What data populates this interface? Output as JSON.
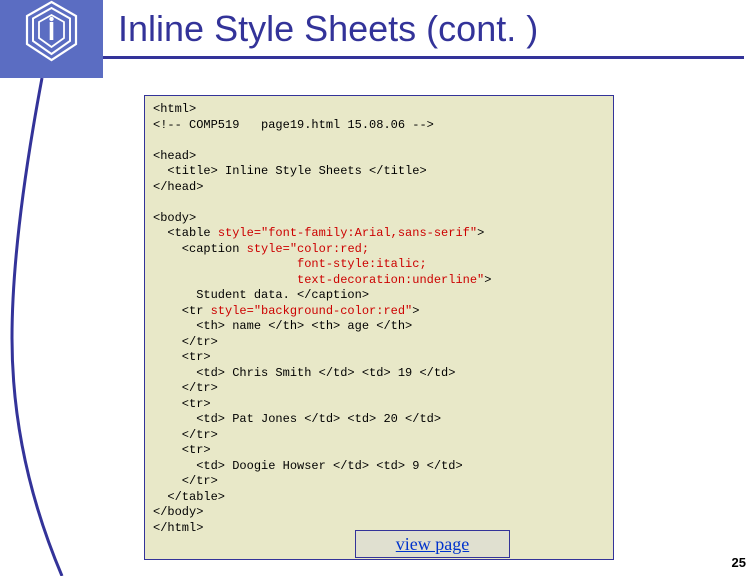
{
  "header": {
    "title": "Inline Style Sheets (cont. )"
  },
  "code": {
    "line1": "<html>",
    "line2": "<!-- COMP519   page19.html 15.08.06 -->",
    "line3": "",
    "line4": "<head>",
    "line5": "  <title> Inline Style Sheets </title>",
    "line6": "</head>",
    "line7": "",
    "line8": "<body>",
    "line9a": "  <table ",
    "line9b": "style=\"font-family:Arial,sans-serif\"",
    "line9c": ">",
    "line10a": "    <caption ",
    "line10b": "style=\"color:red;",
    "line10c": "",
    "line11": "                    font-style:italic;",
    "line12": "                    text-decoration:underline\"",
    "line12c": ">",
    "line13": "      Student data. </caption>",
    "line14a": "    <tr ",
    "line14b": "style=\"background-color:red\"",
    "line14c": ">",
    "line15": "      <th> name </th> <th> age </th>",
    "line16": "    </tr>",
    "line17": "    <tr>",
    "line18": "      <td> Chris Smith </td> <td> 19 </td>",
    "line19": "    </tr>",
    "line20": "    <tr>",
    "line21": "      <td> Pat Jones </td> <td> 20 </td>",
    "line22": "    </tr>",
    "line23": "    <tr>",
    "line24": "      <td> Doogie Howser </td> <td> 9 </td>",
    "line25": "    </tr>",
    "line26": "  </table>",
    "line27": "</body>",
    "line28": "</html>"
  },
  "link": {
    "label": "view page"
  },
  "page_number": "25"
}
